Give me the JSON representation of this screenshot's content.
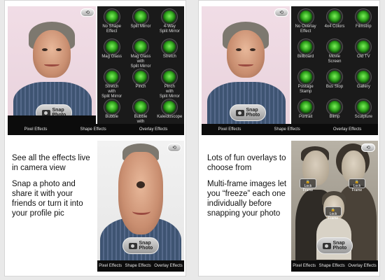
{
  "left_card": {
    "effects": [
      {
        "label": "No Shape\nEffect"
      },
      {
        "label": "Split Mirror"
      },
      {
        "label": "4-Way\nSplit Mirror"
      },
      {
        "label": "Mag Glass"
      },
      {
        "label": "Mag Glass\nwith\nSplit Mirror"
      },
      {
        "label": "Stretch"
      },
      {
        "label": "Stretch\nwith\nSplit Mirror"
      },
      {
        "label": "Pinch"
      },
      {
        "label": "Pinch\nwith\nSplit Mirror"
      },
      {
        "label": "Bubble"
      },
      {
        "label": "Bubble\nwith\nSplit Mirror"
      },
      {
        "label": "Kaleidoscope"
      }
    ],
    "tabs": [
      "Pixel Effects",
      "Shape Effects",
      "Overlay Effects"
    ],
    "snap_label": "Snap Photo",
    "caption_1": "See all the effects live in camera view",
    "caption_2": "Snap a photo and share it with your friends or turn it into your profile pic"
  },
  "right_card": {
    "effects": [
      {
        "label": "No Overlay\nEffect"
      },
      {
        "label": "4x4 Colors"
      },
      {
        "label": "Filmstrip"
      },
      {
        "label": "Billboard"
      },
      {
        "label": "Movie\nScreen"
      },
      {
        "label": "Old TV"
      },
      {
        "label": "Postage\nStamp"
      },
      {
        "label": "Bus Stop"
      },
      {
        "label": "Gallery"
      },
      {
        "label": "Portrait"
      },
      {
        "label": "Blimp"
      },
      {
        "label": "Sculpture"
      }
    ],
    "tabs": [
      "Pixel Effects",
      "Shape Effects",
      "Overlay Effects"
    ],
    "snap_label": "Snap Photo",
    "lock_label": "Lock Frame",
    "caption_1": "Lots of fun overlays to choose from",
    "caption_2": "Multi-frame images let you “freeze” each one individually before snapping your photo"
  },
  "icons": {
    "flip_camera": "flip-camera-icon",
    "camera": "camera-icon",
    "effect_knob": "green-knob-icon"
  },
  "colors": {
    "knob_on": "#2fa31c",
    "panel_bg": "#1a1a1a",
    "tab_bar_bg": "#0c0c0c"
  }
}
